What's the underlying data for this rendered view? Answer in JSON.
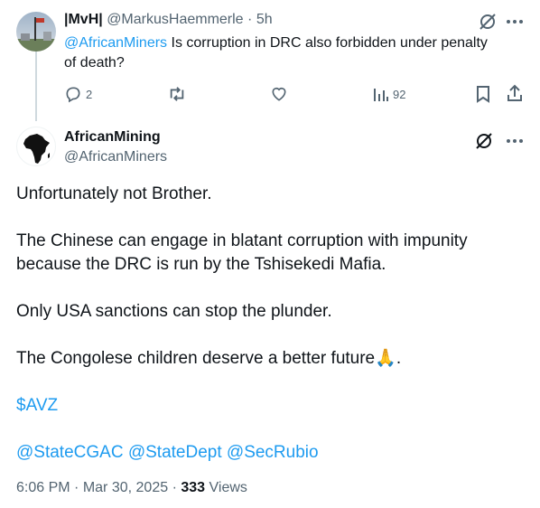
{
  "reply": {
    "display_name": "|MvH|",
    "handle": "@MarkusHaemmerle",
    "separator": "·",
    "time": "5h",
    "mention": "@AfricanMiners",
    "text": " Is corruption in DRC also forbidden under penalty of death?",
    "actions": {
      "replies": "2",
      "views": "92"
    }
  },
  "tweet": {
    "display_name": "AfricanMining",
    "handle": "@AfricanMiners",
    "line1": "Unfortunately not Brother.",
    "line2a": "The Chinese can engage in blatant corruption with impunity",
    "line2b": "because the DRC is run by the Tshisekedi Mafia.",
    "line3": "Only USA sanctions can stop the plunder.",
    "line4": "The Congolese children deserve a better future",
    "line4_end": ".",
    "emoji": "🙏",
    "cashtag": "$AVZ",
    "mentions": [
      "@StateCGAC",
      "@StateDept",
      "@SecRubio"
    ],
    "time": "6:06 PM",
    "dot": "·",
    "date": "Mar 30, 2025",
    "views_count": "333",
    "views_label": "Views"
  },
  "colors": {
    "accent": "#1d9bf0",
    "secondary_text": "#536471",
    "primary_text": "#0f1419",
    "thread_line": "#cfd9de"
  },
  "icons": [
    "grok-icon",
    "more-icon",
    "reply-icon",
    "retweet-icon",
    "like-icon",
    "views-icon",
    "bookmark-icon",
    "share-icon"
  ]
}
